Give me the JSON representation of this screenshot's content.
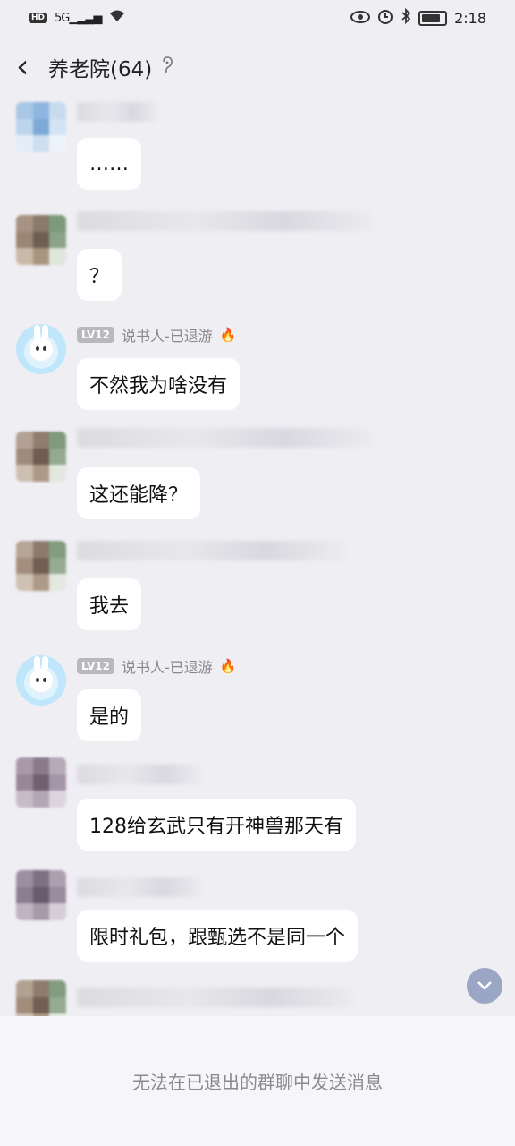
{
  "status_bar": {
    "left_icons": [
      "hd-icon",
      "signal-icon",
      "wifi-icon"
    ],
    "hd_label": "HD",
    "network_label": "5G",
    "right_icons": [
      "eye-icon",
      "alarm-icon",
      "bluetooth-icon",
      "battery-icon"
    ],
    "time": "2:18",
    "battery_level": 0.85
  },
  "header": {
    "back_icon": "chevron-left-icon",
    "title": "养老院(64)",
    "ear_icon": "ear-icon"
  },
  "messages": [
    {
      "sender_visible": false,
      "text": "……"
    },
    {
      "sender_visible": false,
      "text": "？"
    },
    {
      "sender_visible": true,
      "level": "LV12",
      "name": "说书人-已退游",
      "text": "不然我为啥没有"
    },
    {
      "sender_visible": false,
      "text": "这还能降？"
    },
    {
      "sender_visible": false,
      "text": "我去"
    },
    {
      "sender_visible": true,
      "level": "LV12",
      "name": "说书人-已退游",
      "text": "是的"
    },
    {
      "sender_visible": false,
      "text": "128给玄武只有开神兽那天有"
    },
    {
      "sender_visible": false,
      "text": "限时礼包，跟甄选不是同一个"
    }
  ],
  "scroll_icon": "chevron-down-icon",
  "footer": {
    "notice": "无法在已退出的群聊中发送消息"
  },
  "colors": {
    "background": "#efeef3",
    "bubble": "#ffffff",
    "level_badge": "#b8b8bd",
    "fire": "#f06a3c"
  }
}
